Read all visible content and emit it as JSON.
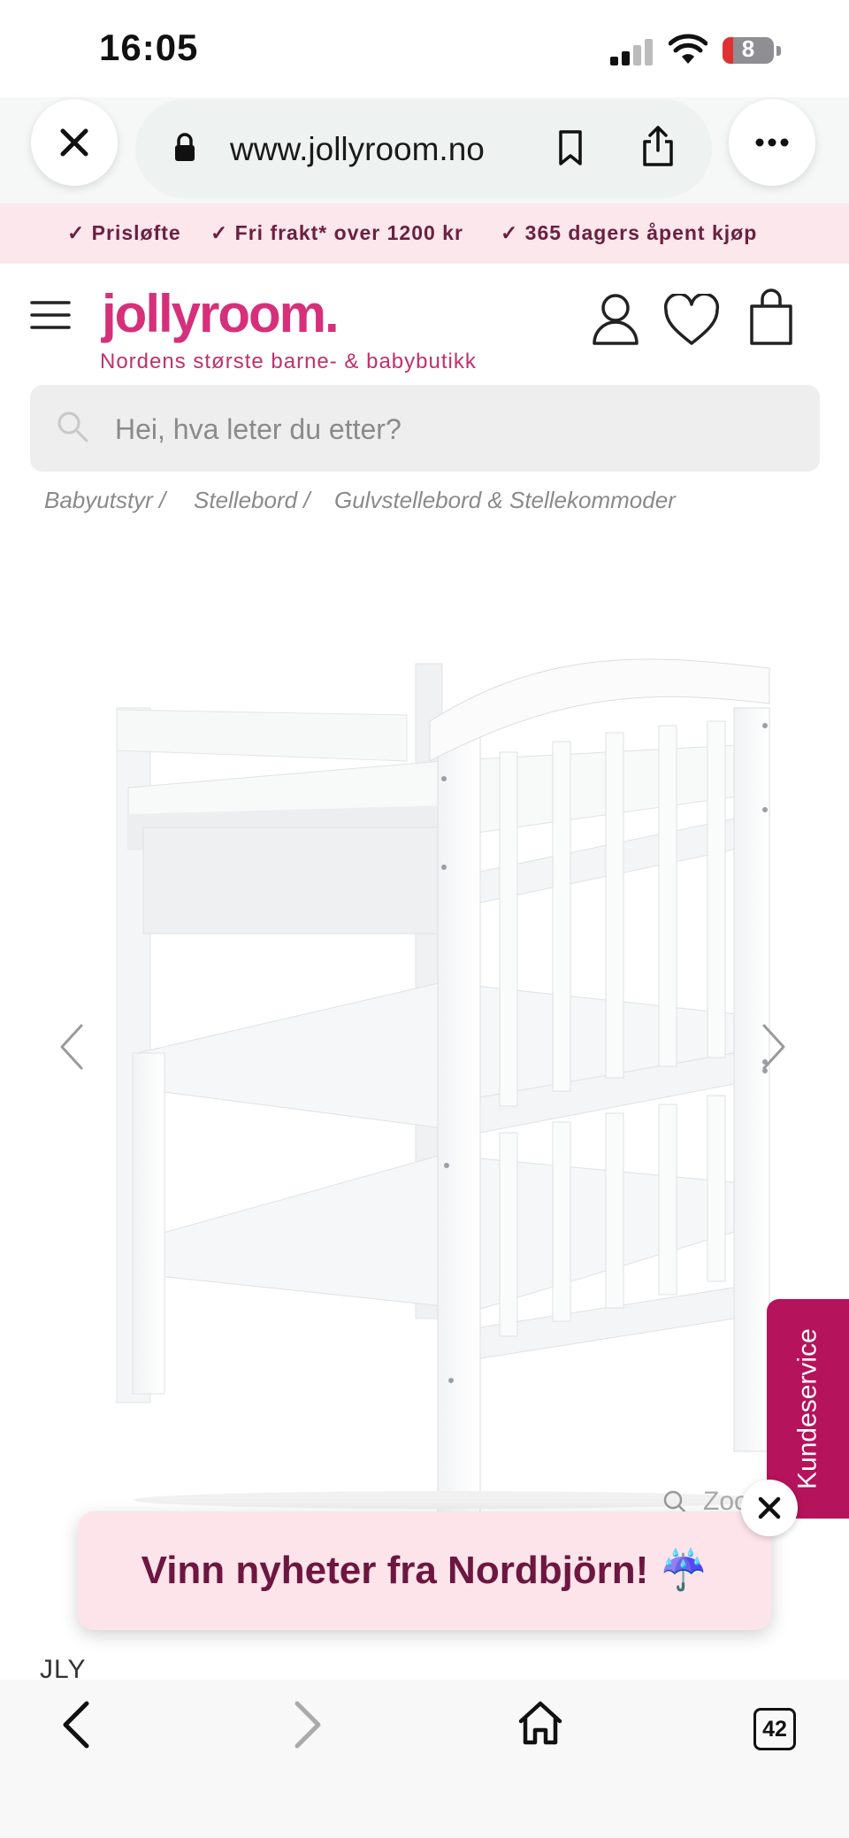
{
  "status_bar": {
    "time": "16:05",
    "battery": "8"
  },
  "browser": {
    "url": "www.jollyroom.no",
    "tabs_count": "42"
  },
  "promo": [
    {
      "label": "Prisløfte"
    },
    {
      "label": "Fri frakt* over 1200 kr"
    },
    {
      "label": "365 dagers åpent kjøp"
    }
  ],
  "header": {
    "logo": "jollyroom.",
    "tagline": "Nordens største barne- & babybutikk"
  },
  "search": {
    "placeholder": "Hei, hva leter du etter?"
  },
  "breadcrumb": [
    {
      "label": "Babyutstyr"
    },
    {
      "label": "Stellebord"
    },
    {
      "label": "Gulvstellebord & Stellekommoder"
    }
  ],
  "product": {
    "brand": "JLY",
    "zoom_label": "Zoo"
  },
  "customer_service": {
    "label": "Kundeservice"
  },
  "banner": {
    "text": "Vinn nyheter fra Nordbjörn! ☔"
  },
  "colors": {
    "brand": "#d6307a",
    "cs_tab": "#b5135b",
    "banner_text": "#6d1640",
    "promo_bg": "#fbe7ec"
  }
}
